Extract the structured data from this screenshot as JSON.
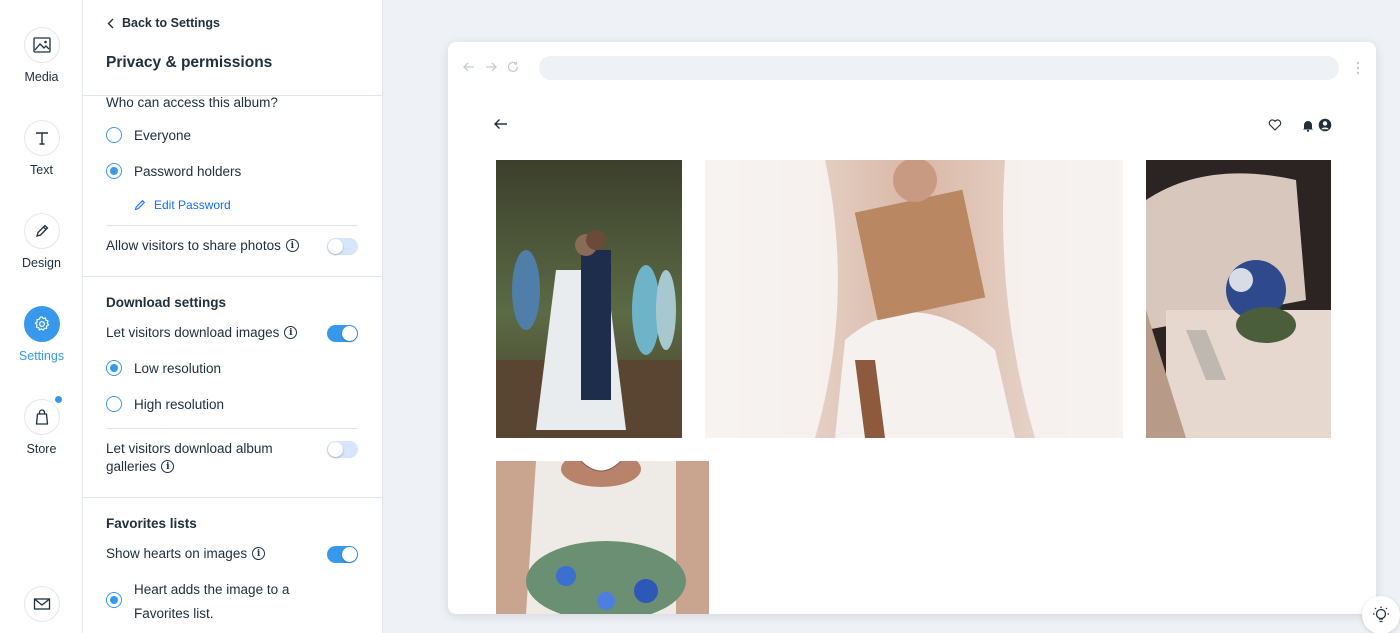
{
  "rail": {
    "items": [
      {
        "label": "Media",
        "icon": "image-icon"
      },
      {
        "label": "Text",
        "icon": "text-icon"
      },
      {
        "label": "Design",
        "icon": "pen-icon"
      },
      {
        "label": "Settings",
        "icon": "gear-icon",
        "active": true
      },
      {
        "label": "Store",
        "icon": "bag-icon",
        "has_notification": true
      }
    ],
    "bottom_icon": "mail-icon"
  },
  "panel": {
    "back_label": "Back to Settings",
    "title": "Privacy & permissions",
    "access": {
      "question": "Who can access this album?",
      "options": [
        {
          "label": "Everyone",
          "selected": false
        },
        {
          "label": "Password holders",
          "selected": true
        }
      ],
      "edit_password_label": "Edit Password"
    },
    "share_photos": {
      "label": "Allow visitors to share photos",
      "enabled": false
    },
    "download": {
      "heading": "Download settings",
      "download_images": {
        "label": "Let visitors download images",
        "enabled": true
      },
      "resolution_options": [
        {
          "label": "Low resolution",
          "selected": true
        },
        {
          "label": "High resolution",
          "selected": false
        }
      ],
      "download_galleries": {
        "label_line1": "Let visitors download album",
        "label_line2": "galleries",
        "enabled": false
      }
    },
    "favorites": {
      "heading": "Favorites lists",
      "show_hearts": {
        "label": "Show hearts on images",
        "enabled": true
      },
      "heart_option": {
        "label_line1": "Heart adds the image to a",
        "label_line2": "Favorites list.",
        "selected": true
      }
    }
  },
  "colors": {
    "accent": "#3899ec",
    "link": "#116dff",
    "text": "#20303c",
    "toggle_off": "#d6e6fe"
  }
}
